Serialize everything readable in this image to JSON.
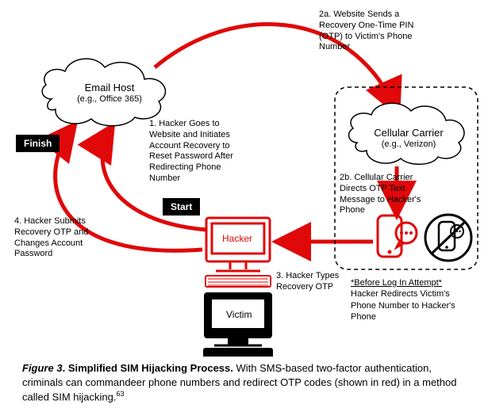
{
  "email_host": {
    "title": "Email Host",
    "sub": "(e.g., Office 365)"
  },
  "carrier": {
    "title": "Cellular Carrier",
    "sub": "(e.g., Verizon)"
  },
  "flags": {
    "start": "Start",
    "finish": "Finish"
  },
  "hacker": "Hacker",
  "victim": "Victim",
  "step1": "1. Hacker Goes to Website and Initiates Account Recovery to Reset Password After Redirecting Phone Number",
  "step2a": "2a. Website Sends a Recovery One-Time PIN (OTP) to Victim's Phone Number",
  "step2b": "2b. Cellular Carrier Directs OTP Text Message to Hacker's Phone",
  "step3": "3. Hacker Types Recovery OTP",
  "step4": "4. Hacker Submits Recovery OTP and Changes Account Password",
  "before": {
    "heading": "*Before Log In Attempt*",
    "body": "Hacker Redirects Victim's Phone Number to Hacker's Phone"
  },
  "caption": {
    "fignum": "Figure 3",
    "title": "Simplified SIM Hijacking Process.",
    "body": "With SMS-based two-factor authentication, criminals can commandeer phone numbers and redirect OTP codes (shown in red) in a method called SIM hijacking.",
    "ref": "63"
  }
}
